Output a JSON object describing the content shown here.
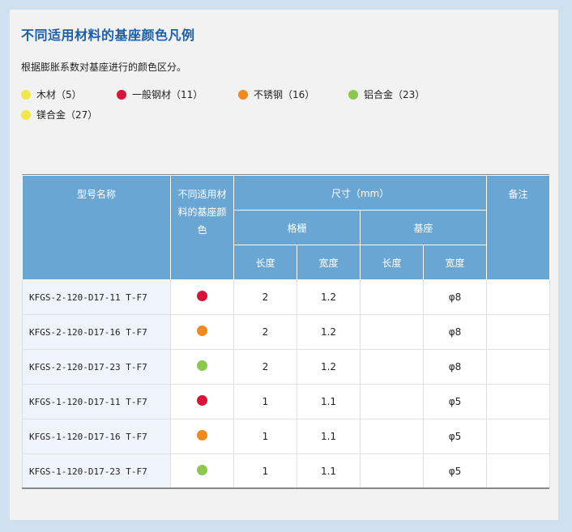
{
  "title": "不同适用材料的基座颜色凡例",
  "description": "根据膨胀系数对基座进行的颜色区分。",
  "legend": [
    {
      "label": "木材（5）",
      "color": "#f2e64a"
    },
    {
      "label": "一般钢材（11）",
      "color": "#d9143a"
    },
    {
      "label": "不锈钢（16）",
      "color": "#f08a1c"
    },
    {
      "label": "铝合金（23）",
      "color": "#8cc84b"
    },
    {
      "label": "镁合金（27）",
      "color": "#f2e64a"
    }
  ],
  "table": {
    "headers": {
      "model": "型号名称",
      "material_color": "不同适用材料的基座颜色",
      "size": "尺寸（mm）",
      "grille": "格栅",
      "base": "基座",
      "grille_length": "长度",
      "grille_width": "宽度",
      "base_length": "长度",
      "base_width": "宽度",
      "note": "备注"
    },
    "rows": [
      {
        "model": "KFGS-2-120-D17-11 T-F7",
        "color": "#d9143a",
        "g_len": "2",
        "g_wid": "1.2",
        "b_len": "",
        "b_wid": "φ8",
        "note": ""
      },
      {
        "model": "KFGS-2-120-D17-16 T-F7",
        "color": "#f08a1c",
        "g_len": "2",
        "g_wid": "1.2",
        "b_len": "",
        "b_wid": "φ8",
        "note": ""
      },
      {
        "model": "KFGS-2-120-D17-23 T-F7",
        "color": "#8cc84b",
        "g_len": "2",
        "g_wid": "1.2",
        "b_len": "",
        "b_wid": "φ8",
        "note": ""
      },
      {
        "model": "KFGS-1-120-D17-11 T-F7",
        "color": "#d9143a",
        "g_len": "1",
        "g_wid": "1.1",
        "b_len": "",
        "b_wid": "φ5",
        "note": ""
      },
      {
        "model": "KFGS-1-120-D17-16 T-F7",
        "color": "#f08a1c",
        "g_len": "1",
        "g_wid": "1.1",
        "b_len": "",
        "b_wid": "φ5",
        "note": ""
      },
      {
        "model": "KFGS-1-120-D17-23 T-F7",
        "color": "#8cc84b",
        "g_len": "1",
        "g_wid": "1.1",
        "b_len": "",
        "b_wid": "φ5",
        "note": ""
      }
    ]
  }
}
